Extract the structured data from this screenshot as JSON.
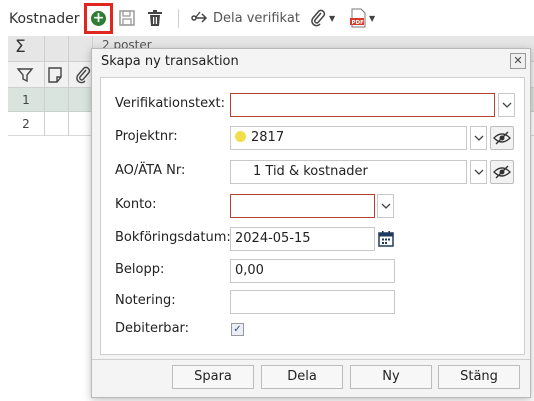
{
  "toolbar": {
    "title": "Kostnader",
    "share_label": "Dela verifikat"
  },
  "grid": {
    "summary": "2 poster",
    "rows": [
      {
        "num": "1"
      },
      {
        "num": "2"
      }
    ]
  },
  "dialog": {
    "title": "Skapa ny transaktion",
    "close_glyph": "✕",
    "fields": {
      "verifikationstext": {
        "label": "Verifikationstext:",
        "value": ""
      },
      "projektnr": {
        "label": "Projektnr:",
        "value": "2817"
      },
      "ao": {
        "label": "AO/ÄTA Nr:",
        "value": "1 Tid & kostnader"
      },
      "konto": {
        "label": "Konto:",
        "value": ""
      },
      "bokforingsdatum": {
        "label": "Bokföringsdatum:",
        "value": "2024-05-15"
      },
      "belopp": {
        "label": "Belopp:",
        "value": "0,00"
      },
      "notering": {
        "label": "Notering:",
        "value": ""
      },
      "debiterbar": {
        "label": "Debiterbar:",
        "checked": true
      }
    },
    "buttons": {
      "spara": "Spara",
      "dela": "Dela",
      "ny": "Ny",
      "stang": "Stäng"
    }
  },
  "colors": {
    "accent_red": "#e0261f",
    "add_green": "#2e7d32",
    "error_border": "#b8402f",
    "project_dot": "#f2dd4b"
  }
}
